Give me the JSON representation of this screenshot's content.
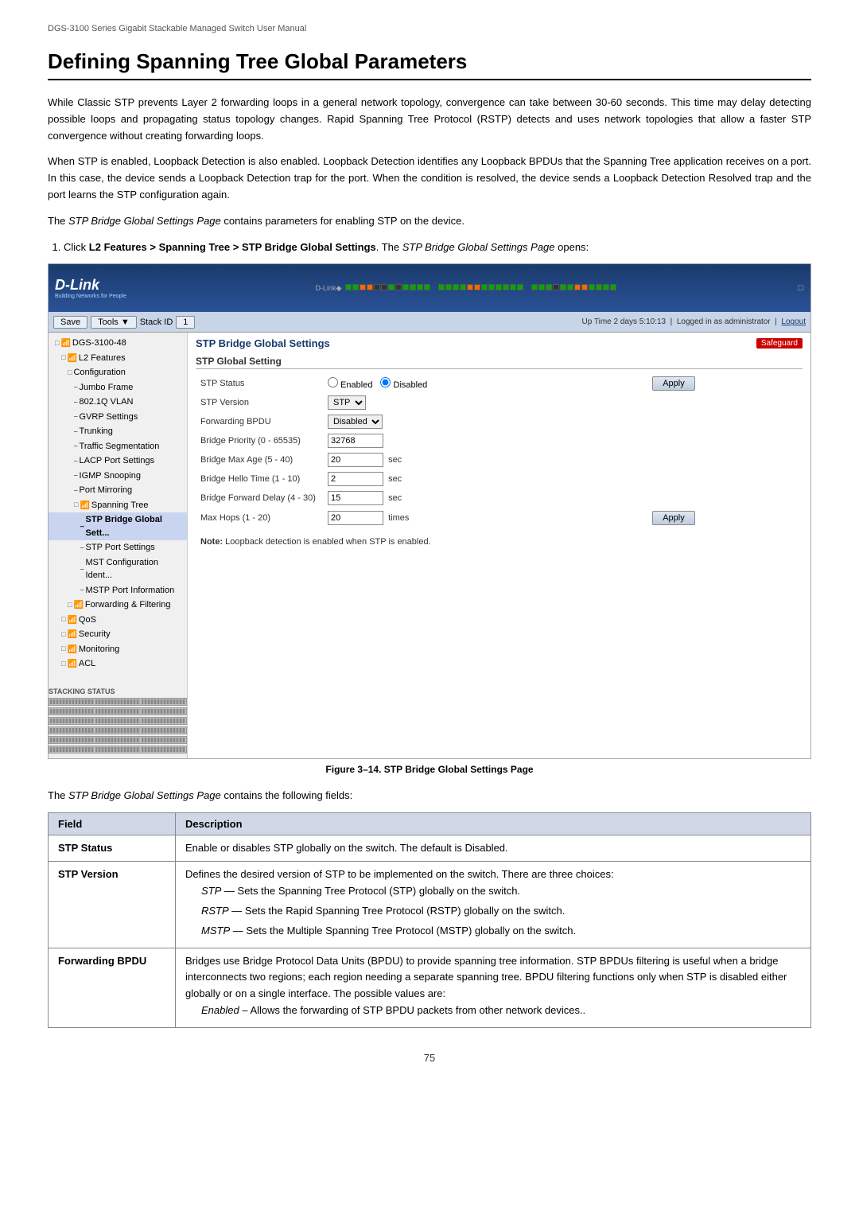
{
  "manual": {
    "header": "DGS-3100 Series Gigabit Stackable Managed Switch User Manual",
    "page_number": "75"
  },
  "page": {
    "title": "Defining Spanning Tree Global Parameters",
    "intro_para1": "While Classic STP prevents Layer 2 forwarding loops in a general network topology, convergence can take between 30-60 seconds. This time may delay detecting possible loops and propagating status topology changes. Rapid Spanning Tree Protocol (RSTP) detects and uses network topologies that allow a faster STP convergence without creating forwarding loops.",
    "intro_para2": "When STP is enabled, Loopback Detection is also enabled. Loopback Detection identifies any Loopback BPDUs that the Spanning Tree application receives on a port. In this case, the device sends a Loopback Detection trap for the port. When the condition is resolved, the device sends a Loopback Detection Resolved trap and the port learns the STP configuration again.",
    "stp_page_text": "The STP Bridge Global Settings Page contains parameters for enabling STP on the device.",
    "instruction": "Click L2 Features > Spanning Tree > STP Bridge Global Settings. The STP Bridge Global Settings Page opens:"
  },
  "toolbar": {
    "save_label": "Save",
    "tools_label": "Tools",
    "stack_id_label": "Stack ID",
    "stack_id_value": "1",
    "uptime": "Up Time 2 days 5:10:13",
    "logged_in": "Logged in as administrator",
    "logout_label": "Logout"
  },
  "sidebar": {
    "items": [
      {
        "label": "DGS-3100-48",
        "level": 0,
        "has_icon": true
      },
      {
        "label": "L2 Features",
        "level": 1,
        "has_icon": true
      },
      {
        "label": "Configuration",
        "level": 2
      },
      {
        "label": "Jumbo Frame",
        "level": 3
      },
      {
        "label": "802.1Q VLAN",
        "level": 3
      },
      {
        "label": "GVRP Settings",
        "level": 3
      },
      {
        "label": "Trunking",
        "level": 3
      },
      {
        "label": "Traffic Segmentation",
        "level": 3
      },
      {
        "label": "LACP Port Settings",
        "level": 3
      },
      {
        "label": "IGMP Snooping",
        "level": 3
      },
      {
        "label": "Port Mirroring",
        "level": 3
      },
      {
        "label": "Spanning Tree",
        "level": 3,
        "has_icon": true,
        "active": false
      },
      {
        "label": "STP Bridge Global Sett...",
        "level": 4,
        "active": true
      },
      {
        "label": "STP Port Settings",
        "level": 4
      },
      {
        "label": "MST Configuration Ident...",
        "level": 4
      },
      {
        "label": "MSTP Port Information",
        "level": 4
      },
      {
        "label": "Forwarding & Filtering",
        "level": 2,
        "has_icon": true
      },
      {
        "label": "QoS",
        "level": 1,
        "has_icon": true
      },
      {
        "label": "Security",
        "level": 1,
        "has_icon": true
      },
      {
        "label": "Monitoring",
        "level": 1,
        "has_icon": true
      },
      {
        "label": "ACL",
        "level": 1,
        "has_icon": true
      }
    ]
  },
  "content": {
    "title": "STP Bridge Global Settings",
    "safeguard": "Safeguard",
    "section_label": "STP Global Setting",
    "fields": {
      "stp_status_label": "STP Status",
      "stp_status_enabled": "Enabled",
      "stp_status_disabled": "Disabled",
      "stp_status_value": "Disabled",
      "stp_version_label": "STP Version",
      "stp_version_value": "STP",
      "forwarding_bpdu_label": "Forwarding BPDU",
      "forwarding_bpdu_value": "Disabled",
      "bridge_priority_label": "Bridge Priority (0 - 65535)",
      "bridge_priority_value": "32768",
      "bridge_max_age_label": "Bridge Max Age (5 - 40)",
      "bridge_max_age_value": "20",
      "bridge_max_age_unit": "sec",
      "bridge_hello_time_label": "Bridge Hello Time (1 - 10)",
      "bridge_hello_time_value": "2",
      "bridge_hello_time_unit": "sec",
      "bridge_forward_delay_label": "Bridge Forward Delay (4 - 30)",
      "bridge_forward_delay_value": "15",
      "bridge_forward_delay_unit": "sec",
      "max_hops_label": "Max Hops (1 - 20)",
      "max_hops_value": "20",
      "max_hops_unit": "times"
    },
    "apply_label": "Apply",
    "note": "Note: Loopback detection is enabled when STP is enabled."
  },
  "figure_caption": "Figure 3–14. STP Bridge Global Settings Page",
  "table": {
    "intro": "The STP Bridge Global Settings Page contains the following fields:",
    "col_field": "Field",
    "col_description": "Description",
    "rows": [
      {
        "field": "STP Status",
        "description": "Enable or disables STP globally on the switch. The default is Disabled."
      },
      {
        "field": "STP Version",
        "description": "Defines the desired version of STP to be implemented on the switch. There are three choices:",
        "sub_items": [
          "STP — Sets the Spanning Tree Protocol (STP) globally on the switch.",
          "RSTP — Sets the Rapid Spanning Tree Protocol (RSTP) globally on the switch.",
          "MSTP — Sets the Multiple Spanning Tree Protocol (MSTP) globally on the switch."
        ]
      },
      {
        "field": "Forwarding BPDU",
        "description": "Bridges use Bridge Protocol Data Units (BPDU) to provide spanning tree information. STP BPDUs filtering is useful when a bridge interconnects two regions; each region needing a separate spanning tree. BPDU filtering functions only when STP is disabled either globally or on a single interface. The possible values are:",
        "sub_items": [
          "Enabled – Allows the forwarding of STP BPDU packets from other network devices.."
        ]
      }
    ]
  }
}
